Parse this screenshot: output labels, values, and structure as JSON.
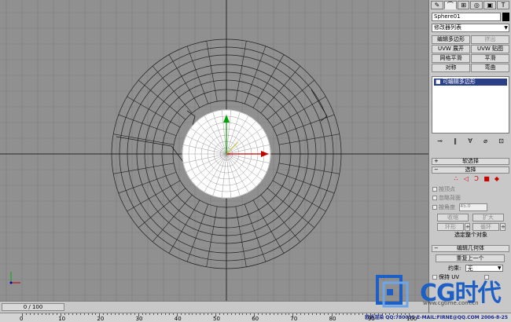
{
  "panel": {
    "object_name": "Sphere01",
    "modifier_list": "修改器列表",
    "buttons": [
      {
        "label": "编辑多边形",
        "dim": false
      },
      {
        "label": "挤出",
        "dim": true
      },
      {
        "label": "UVW 展开",
        "dim": false
      },
      {
        "label": "UVW 贴图",
        "dim": false
      },
      {
        "label": "网格平滑",
        "dim": false
      },
      {
        "label": "平滑",
        "dim": false
      },
      {
        "label": "对称",
        "dim": false
      },
      {
        "label": "弯曲",
        "dim": false
      }
    ],
    "stack_item": "可编辑多边形",
    "rollouts": {
      "soft_selection": "软选择",
      "selection": "选择",
      "edit_geometry": "编辑几何体"
    },
    "selection": {
      "by_vertex": "按顶点",
      "ignore_backfacing": "忽略背面",
      "by_angle": "按角度",
      "angle_value": "45.0",
      "shrink": "收缩",
      "grow": "扩大",
      "ring": "环形",
      "loop": "循环",
      "selected_summary": "选定整个对象"
    },
    "edit_geometry": {
      "repeat_last": "重复上一个",
      "constraint_label": "约束:",
      "constraint_value": "无",
      "preserve_uv": "保持 UV"
    }
  },
  "timeline": {
    "frame_display": "0 / 100",
    "ruler_labels": [
      "0",
      "10",
      "20",
      "30",
      "40",
      "50",
      "60",
      "70",
      "80",
      "90",
      "100"
    ]
  },
  "footer": {
    "credit": "欧帆渲染 QQ:780095 E-MAIL:FIRNE@QQ.COM 2006-8-25"
  },
  "watermark": {
    "brand": "CG时代",
    "url": "www.cgtime.com.cn"
  }
}
